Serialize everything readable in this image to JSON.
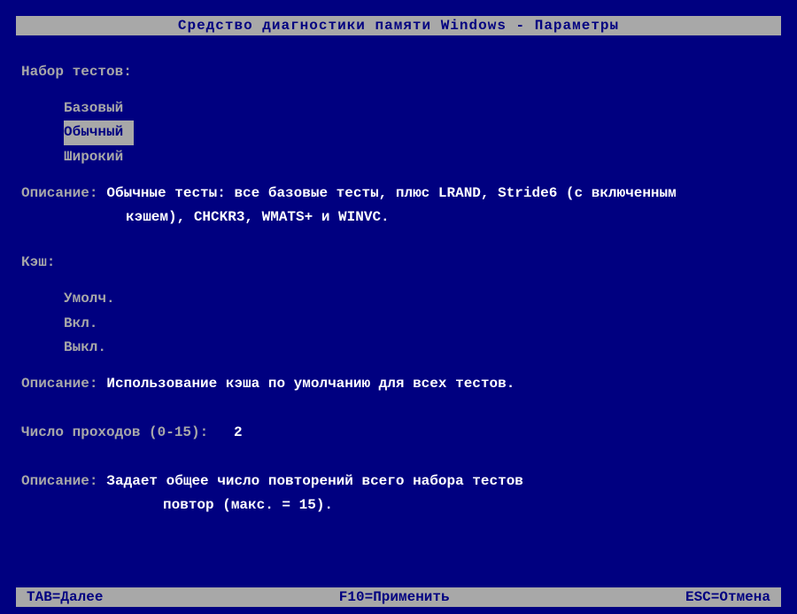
{
  "title": "Средство диагностики памяти Windows - Параметры",
  "testSet": {
    "label": "Набор тестов:",
    "options": [
      "Базовый",
      "Обычный",
      "Широкий"
    ],
    "selectedIndex": 1
  },
  "testSetDesc": {
    "label": "Описание:",
    "line1": "Обычные тесты: все базовые тесты, плюс LRAND, Stride6 (с включенным",
    "line2": "кэшем), CHCKR3, WMATS+ и WINVC."
  },
  "cache": {
    "label": "Кэш:",
    "options": [
      "Умолч.",
      "Вкл.",
      "Выкл."
    ]
  },
  "cacheDesc": {
    "label": "Описание:",
    "text": "Использование кэша по умолчанию для всех тестов."
  },
  "pass": {
    "label": "Число проходов (0-15):",
    "value": "2"
  },
  "passDesc": {
    "label": "Описание:",
    "line1": "Задает общее число повторений всего набора тестов",
    "line2": "повтор (макс. = 15)."
  },
  "footer": {
    "tab": "TAB=Далее",
    "f10": "F10=Применить",
    "esc": "ESC=Отмена"
  }
}
